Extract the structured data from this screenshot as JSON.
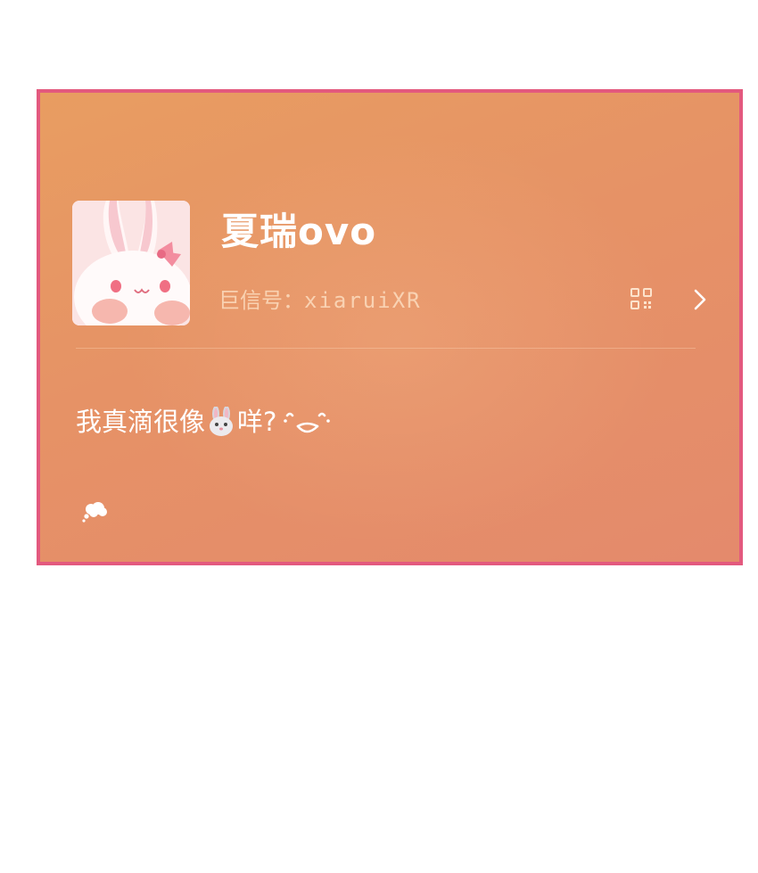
{
  "profile": {
    "display_name": "夏瑞ovo",
    "id_label": "巨信号：",
    "id_value": "xiaruiXR",
    "bio_before_emoji": "我真滴很像",
    "bio_after_emoji": "咩?",
    "avatar_icon": "bunny-avatar",
    "emoji_icon": "rabbit-face-icon",
    "kaomoji_icon": "kaomoji-icon"
  },
  "icons": {
    "qr": "qr-code-icon",
    "chevron": "chevron-right-icon",
    "thought": "thought-bubble-icon"
  },
  "colors": {
    "card_border": "#e3597e",
    "card_background_start": "#e89d61",
    "card_background_end": "#e48a6c",
    "text_primary": "#ffffff"
  }
}
